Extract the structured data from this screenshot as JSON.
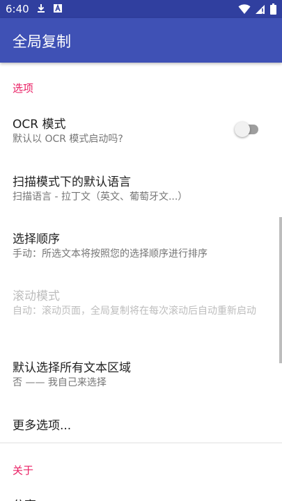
{
  "status_bar": {
    "time": "6:40",
    "icons": [
      "download-icon",
      "notification-a-icon",
      "wifi-icon",
      "signal-icon",
      "battery-icon"
    ]
  },
  "app_bar": {
    "title": "全局复制"
  },
  "sections": {
    "options": {
      "header": "选项",
      "ocr_mode": {
        "title": "OCR 模式",
        "summary": "默认以 OCR 模式启动吗?",
        "switch_on": false
      },
      "scan_language": {
        "title": "扫描模式下的默认语言",
        "summary": "扫描语言 - 拉丁文（英文、葡萄牙文...）"
      },
      "selection_order": {
        "title": "选择顺序",
        "summary": "手动：所选文本将按照您的选择顺序进行排序"
      },
      "scroll_mode": {
        "title": "滚动模式",
        "summary": "自动：滚动页面，全局复制将在每次滚动后自动重新启动",
        "enabled": false
      },
      "select_all_text": {
        "title": "默认选择所有文本区域",
        "summary": "否 —— 我自己来选择"
      },
      "more_options": {
        "title": "更多选项..."
      }
    },
    "about": {
      "header": "关于",
      "share": {
        "title": "分享"
      }
    }
  },
  "colors": {
    "status_bar": "#303f9f",
    "app_bar": "#3f51b5",
    "accent": "#e91e63",
    "primary_text": "#212121",
    "secondary_text": "#757575",
    "disabled_text": "#bdbdbd"
  }
}
